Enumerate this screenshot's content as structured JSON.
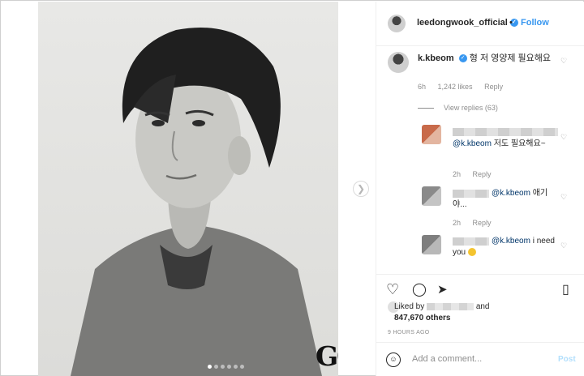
{
  "post": {
    "media": {
      "brand": "GQ",
      "carousel_count": 6,
      "carousel_active": 1
    },
    "header": {
      "username": "leedongwook_official",
      "separator": "•",
      "follow_label": "Follow"
    },
    "top_comment": {
      "username": "k.kbeom",
      "text": "형 저 영양제 필요해요",
      "time": "6h",
      "likes": "1,242 likes",
      "reply_label": "Reply",
      "view_replies": "View replies (63)"
    },
    "replies": [
      {
        "mention": "@k.kbeom",
        "text": " 저도 필요해요~",
        "time": "2h",
        "reply_label": "Reply"
      },
      {
        "mention": "@k.kbeom",
        "text": " 애기야...",
        "time": "2h",
        "reply_label": "Reply"
      },
      {
        "mention": "@k.kbeom",
        "text": " i need you",
        "time": "",
        "reply_label": ""
      }
    ],
    "liked_by_prefix": "Liked by",
    "liked_by_suffix": "and",
    "likes_count": "847,670 others",
    "time_ago": "9 HOURS AGO",
    "add_comment": {
      "placeholder": "Add a comment...",
      "post_label": "Post"
    },
    "icons": {
      "like": "heart-icon",
      "comment": "comment-icon",
      "share": "share-icon",
      "save": "bookmark-icon",
      "next": "chevron-right-icon",
      "emoji": "smile-icon"
    },
    "colors": {
      "link": "#3897f0",
      "muted": "#8e8e8e",
      "text": "#262626",
      "post_disabled": "#b2dffc"
    }
  }
}
